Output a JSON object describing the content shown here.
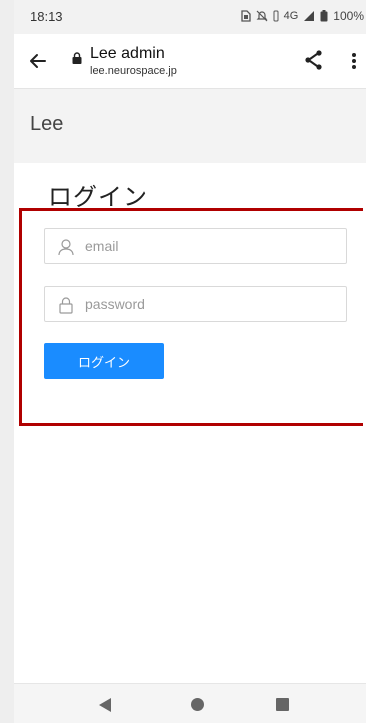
{
  "status_bar": {
    "time": "18:13",
    "network": "4G",
    "battery": "100%",
    "icons": [
      "sim-icon",
      "mute-icon",
      "vibrate-icon",
      "signal-icon",
      "battery-icon"
    ]
  },
  "browser": {
    "back_icon": "arrow-left-icon",
    "title": "Lee admin",
    "host": "lee.neurospace.jp",
    "share_icon": "share-icon",
    "more_icon": "more-vert-icon"
  },
  "app": {
    "brand": "Lee"
  },
  "login": {
    "title": "ログイン",
    "email_placeholder": "email",
    "email_value": "",
    "password_placeholder": "password",
    "password_value": "",
    "submit_label": "ログイン"
  },
  "colors": {
    "primary": "#1a8cff",
    "highlight": "#b00000",
    "header_bg": "#f3f3f3"
  },
  "nav_bar": {
    "icons": [
      "nav-back-icon",
      "nav-home-icon",
      "nav-recents-icon"
    ]
  }
}
